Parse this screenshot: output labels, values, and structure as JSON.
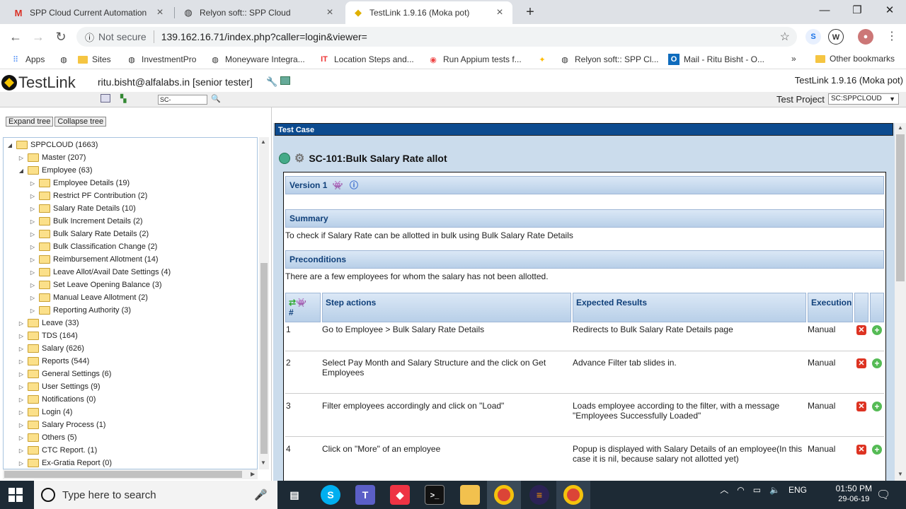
{
  "browser": {
    "tabs": [
      {
        "title": "SPP Cloud Current Automation S",
        "icon": "gmail-icon"
      },
      {
        "title": "Relyon soft:: SPP Cloud",
        "icon": "globe-icon"
      },
      {
        "title": "TestLink 1.9.16 (Moka pot)",
        "icon": "testlink-icon"
      }
    ],
    "not_secure": "Not secure",
    "url": "139.162.16.71/index.php?caller=login&viewer=",
    "bookmarks": [
      "Apps",
      "Sites",
      "InvestmentPro",
      "Moneyware Integra...",
      "Location Steps and...",
      "Run Appium tests f...",
      "Relyon soft:: SPP Cl...",
      "Mail - Ritu Bisht - O...",
      "Other bookmarks"
    ],
    "more_bookmarks": "»",
    "profile_initial": "W"
  },
  "header": {
    "logo_text": "TestLink",
    "user": "ritu.bisht@alfalabs.in [senior tester]",
    "version": "TestLink 1.9.16 (Moka pot)",
    "search_value": "SC-",
    "project_label": "Test Project",
    "project_value": "SC:SPPCLOUD"
  },
  "tree": {
    "expand_label": "Expand tree",
    "collapse_label": "Collapse tree",
    "nodes": [
      {
        "label": "SPPCLOUD (1663)",
        "level": 0,
        "toggle": "◢"
      },
      {
        "label": "Master (207)",
        "level": 1,
        "toggle": "▷"
      },
      {
        "label": "Employee (63)",
        "level": 1,
        "toggle": "◢"
      },
      {
        "label": "Employee Details (19)",
        "level": 2,
        "toggle": "▷"
      },
      {
        "label": "Restrict PF Contribution (2)",
        "level": 2,
        "toggle": "▷"
      },
      {
        "label": "Salary Rate Details (10)",
        "level": 2,
        "toggle": "▷"
      },
      {
        "label": "Bulk Increment Details (2)",
        "level": 2,
        "toggle": "▷"
      },
      {
        "label": "Bulk Salary Rate Details (2)",
        "level": 2,
        "toggle": "▷"
      },
      {
        "label": "Bulk Classification Change (2)",
        "level": 2,
        "toggle": "▷"
      },
      {
        "label": "Reimbursement Allotment (14)",
        "level": 2,
        "toggle": "▷"
      },
      {
        "label": "Leave Allot/Avail Date Settings (4)",
        "level": 2,
        "toggle": "▷"
      },
      {
        "label": "Set Leave Opening Balance (3)",
        "level": 2,
        "toggle": "▷"
      },
      {
        "label": "Manual Leave Allotment (2)",
        "level": 2,
        "toggle": "▷"
      },
      {
        "label": "Reporting Authority (3)",
        "level": 2,
        "toggle": "▷"
      },
      {
        "label": "Leave (33)",
        "level": 1,
        "toggle": "▷"
      },
      {
        "label": "TDS (164)",
        "level": 1,
        "toggle": "▷"
      },
      {
        "label": "Salary (626)",
        "level": 1,
        "toggle": "▷"
      },
      {
        "label": "Reports (544)",
        "level": 1,
        "toggle": "▷"
      },
      {
        "label": "General Settings (6)",
        "level": 1,
        "toggle": "▷"
      },
      {
        "label": "User Settings (9)",
        "level": 1,
        "toggle": "▷"
      },
      {
        "label": "Notifications (0)",
        "level": 1,
        "toggle": "▷"
      },
      {
        "label": "Login (4)",
        "level": 1,
        "toggle": "▷"
      },
      {
        "label": "Salary Process (1)",
        "level": 1,
        "toggle": "▷"
      },
      {
        "label": "Others (5)",
        "level": 1,
        "toggle": "▷"
      },
      {
        "label": "CTC Report. (1)",
        "level": 1,
        "toggle": "▷"
      },
      {
        "label": "Ex-Gratia Report (0)",
        "level": 1,
        "toggle": "▷"
      }
    ]
  },
  "testcase": {
    "panel_title": "Test Case",
    "title": "SC-101:Bulk Salary Rate allot",
    "version_label": "Version 1",
    "summary_label": "Summary",
    "summary_text": "To check if Salary Rate can be allotted in bulk using Bulk Salary Rate Details",
    "preconditions_label": "Preconditions",
    "preconditions_text": "There are a few employees for whom the salary has not been allotted.",
    "columns": {
      "num": "#",
      "actions": "Step actions",
      "expected": "Expected Results",
      "execution": "Execution"
    },
    "steps": [
      {
        "num": "1",
        "action": "Go to Employee > Bulk Salary Rate Details",
        "expected": "Redirects to Bulk Salary Rate Details page",
        "execution": "Manual"
      },
      {
        "num": "2",
        "action": "Select Pay Month  and Salary Structure and the click on Get Employees",
        "expected": "Advance Filter tab slides in.",
        "execution": "Manual"
      },
      {
        "num": "3",
        "action": "Filter employees accordingly and click on \"Load\"",
        "expected": "Loads employee according to the filter, with a message \"Employees Successfully Loaded\"",
        "execution": "Manual"
      },
      {
        "num": "4",
        "action": "Click on \"More\" of an employee",
        "expected": "Popup is displayed with Salary Details of an employee(In this case it is nil, because salary not allotted yet)",
        "execution": "Manual"
      }
    ]
  },
  "taskbar": {
    "search_placeholder": "Type here to search",
    "language": "ENG",
    "time": "01:50 PM",
    "date": "29-06-19"
  }
}
